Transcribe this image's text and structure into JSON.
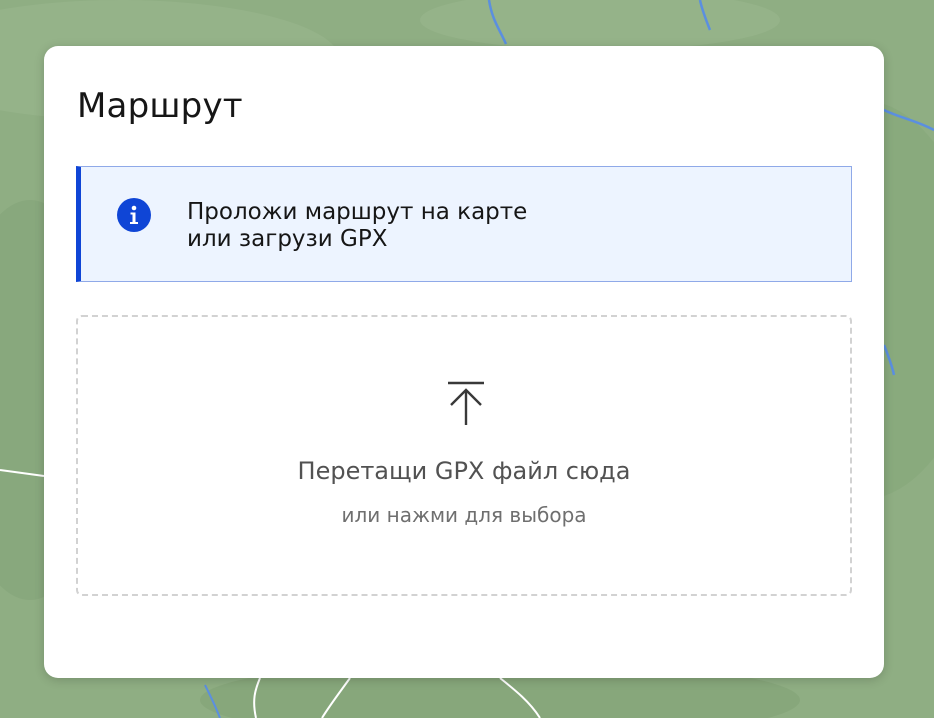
{
  "panel": {
    "title": "Маршрут"
  },
  "notice": {
    "icon": "info-icon",
    "accent_color": "#0f45d6",
    "line1": "Проложи маршрут на карте",
    "line2": "или загрузи GPX"
  },
  "dropzone": {
    "icon": "upload-icon",
    "primary_text": "Перетащи GPX файл сюда",
    "secondary_text": "или нажми для выбора"
  },
  "colors": {
    "map_background": "#8fae83",
    "panel_background": "#ffffff",
    "notice_background": "#edf4ff",
    "water": "#5b8fe0",
    "roads": "#ffffff"
  }
}
